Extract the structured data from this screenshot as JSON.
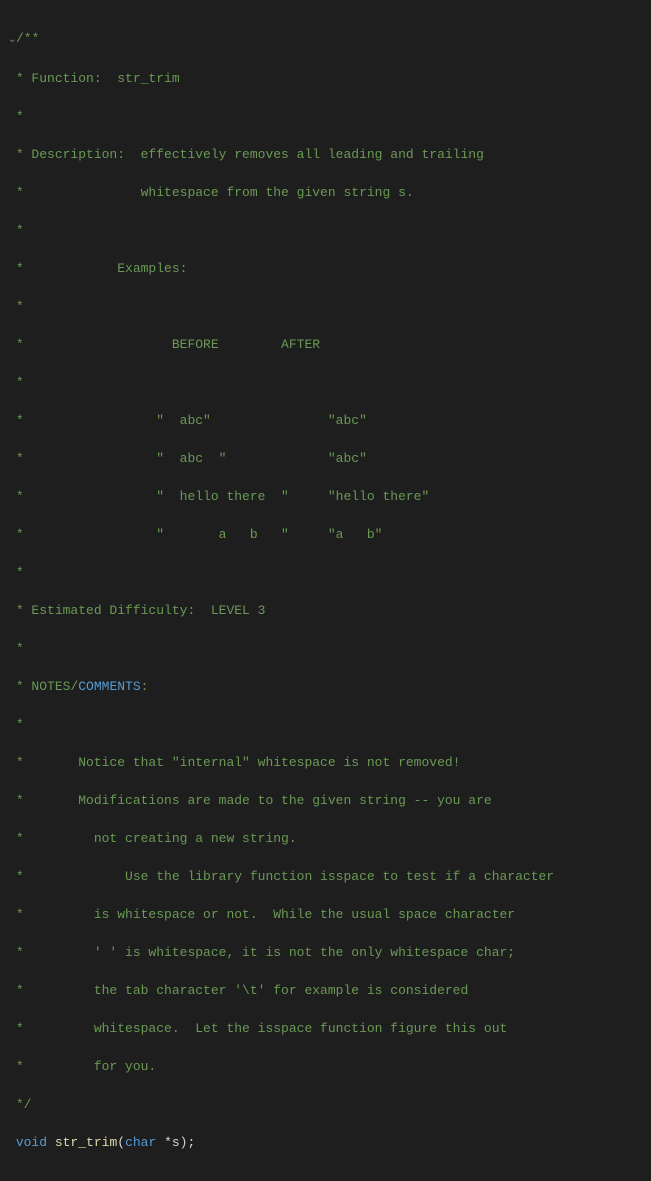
{
  "code": {
    "l1": "/**",
    "l2": "* Function:  str_trim",
    "l3": "*",
    "l4": "* Description:  effectively removes all leading and trailing",
    "l5": "*               whitespace from the given string s.",
    "l6": "*",
    "l7": "*            Examples:",
    "l8": "*",
    "l9": "*                   BEFORE        AFTER",
    "l10": "*",
    "l11": "*                 \"  abc\"               \"abc\"",
    "l12": "*                 \"  abc  \"             \"abc\"",
    "l13": "*                 \"  hello there  \"     \"hello there\"",
    "l14": "*                 \"       a   b   \"     \"a   b\"",
    "l15": "*",
    "l16": "* Estimated Difficulty:  LEVEL 3",
    "l17": "*",
    "l18_a": "* NOTES/",
    "l18_b": "COMMENTS",
    "l18_c": ":",
    "l19": "*",
    "l20": "*       Notice that \"internal\" whitespace is not removed!",
    "l21": "*       Modifications are made to the given string -- you are",
    "l22": "*         not creating a new string.",
    "l23": "*             Use the library function isspace to test if a character",
    "l24": "*         is whitespace or not.  While the usual space character",
    "l25": "*         ' ' is whitespace, it is not the only whitespace char;",
    "l26": "*         the tab character '\\t' for example is considered",
    "l27": "*         whitespace.  Let the isspace function figure this out",
    "l28": "*         for you.",
    "l29": "*/",
    "fn_keyword": "void",
    "fn_name": " str_trim",
    "fn_paren_open": "(",
    "fn_param_type": "char",
    "fn_param_rest": " *s);"
  },
  "gutter_arrow": "⌄"
}
